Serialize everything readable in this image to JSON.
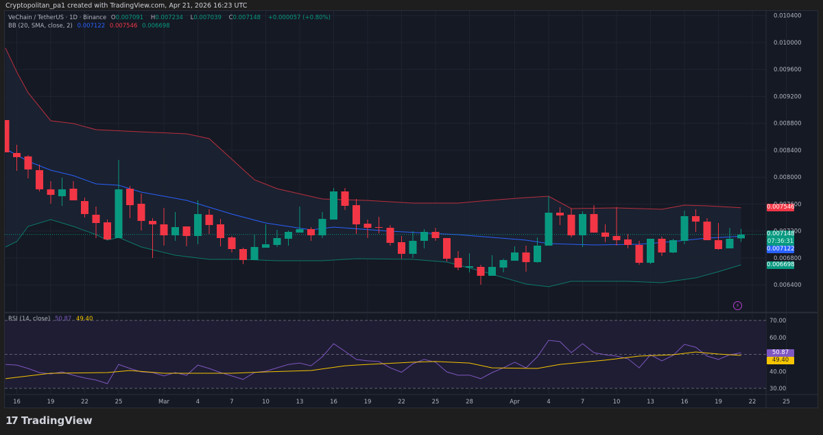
{
  "credit": "Cryptopolitan_pa1 created with TradingView.com, Apr 21, 2026 16:23 UTC",
  "legend": {
    "symbol": "VeChain / TetherUS · 1D · Binance",
    "o_label": "O",
    "o_value": "0.007091",
    "h_label": "H",
    "h_value": "0.007234",
    "l_label": "L",
    "l_value": "0.007039",
    "c_label": "C",
    "c_value": "0.007148",
    "change": "+0.000057 (+0.80%)",
    "bb_label": "BB (20, SMA, close, 2)",
    "bb_basis": "0.007122",
    "bb_upper": "0.007546",
    "bb_lower": "0.006698"
  },
  "rsi_legend": {
    "label": "RSI (14, close)",
    "rsi": "50.87",
    "ma": "49.40"
  },
  "tags": {
    "upper": "0.007546",
    "last": "0.007148",
    "countdown": "07:36:31",
    "basis": "0.007122",
    "lower": "0.006698",
    "rsi": "50.87",
    "rsi_ma": "49.40"
  },
  "colors": {
    "up": "#089981",
    "down": "#f23645",
    "bb_basis": "#2962ff",
    "bb_upper": "#f23645",
    "bb_lower": "#089981",
    "rsi": "#7e57c2",
    "rsi_ma": "#f7c600"
  },
  "footer": {
    "brand": "TradingView"
  },
  "icons": {
    "alert": "lightning-bolt-icon",
    "logo": "tradingview-logo-icon"
  },
  "chart_data": {
    "type": "candlestick",
    "price_axis": {
      "min": 0.0064,
      "max": 0.0104,
      "ticks": [
        "0.010400",
        "0.010000",
        "0.009600",
        "0.009200",
        "0.008800",
        "0.008400",
        "0.008000",
        "0.007600",
        "0.007200",
        "0.006800",
        "0.006400"
      ]
    },
    "rsi_axis": {
      "ticks": [
        "70.00",
        "60.00",
        "40.00",
        "30.00"
      ],
      "bands": [
        70,
        50,
        30
      ]
    },
    "x_ticks": [
      {
        "label": "16",
        "date": "2026-02-16"
      },
      {
        "label": "19",
        "date": "2026-02-19"
      },
      {
        "label": "22",
        "date": "2026-02-22"
      },
      {
        "label": "25",
        "date": "2026-02-25"
      },
      {
        "label": "Mar",
        "date": "2026-03-01"
      },
      {
        "label": "4",
        "date": "2026-03-04"
      },
      {
        "label": "7",
        "date": "2026-03-07"
      },
      {
        "label": "10",
        "date": "2026-03-10"
      },
      {
        "label": "13",
        "date": "2026-03-13"
      },
      {
        "label": "16",
        "date": "2026-03-16"
      },
      {
        "label": "19",
        "date": "2026-03-19"
      },
      {
        "label": "22",
        "date": "2026-03-22"
      },
      {
        "label": "25",
        "date": "2026-03-25"
      },
      {
        "label": "28",
        "date": "2026-03-28"
      },
      {
        "label": "Apr",
        "date": "2026-04-01"
      },
      {
        "label": "4",
        "date": "2026-04-04"
      },
      {
        "label": "7",
        "date": "2026-04-07"
      },
      {
        "label": "10",
        "date": "2026-04-10"
      },
      {
        "label": "13",
        "date": "2026-04-13"
      },
      {
        "label": "16",
        "date": "2026-04-16"
      },
      {
        "label": "19",
        "date": "2026-04-19"
      },
      {
        "label": "22",
        "date": "2026-04-22"
      },
      {
        "label": "25",
        "date": "2026-04-25"
      }
    ],
    "candles": {
      "start_date": "2026-02-15",
      "fields": [
        "open",
        "high",
        "low",
        "close"
      ],
      "rows": [
        [
          0.008848,
          0.008848,
          0.008369,
          0.008369
        ],
        [
          0.008359,
          0.008481,
          0.008094,
          0.008297
        ],
        [
          0.008308,
          0.008328,
          0.007982,
          0.008114
        ],
        [
          0.008104,
          0.008185,
          0.007788,
          0.007819
        ],
        [
          0.007819,
          0.007941,
          0.007605,
          0.007737
        ],
        [
          0.007717,
          0.007992,
          0.007574,
          0.007819
        ],
        [
          0.007829,
          0.007941,
          0.007656,
          0.007656
        ],
        [
          0.007645,
          0.007696,
          0.007401,
          0.007452
        ],
        [
          0.007442,
          0.007564,
          0.007095,
          0.007319
        ],
        [
          0.007329,
          0.00737,
          0.007064,
          0.007075
        ],
        [
          0.007095,
          0.008257,
          0.007095,
          0.007819
        ],
        [
          0.007829,
          0.00787,
          0.007391,
          0.007584
        ],
        [
          0.007605,
          0.007757,
          0.007207,
          0.00735
        ],
        [
          0.00735,
          0.007391,
          0.0068,
          0.007299
        ],
        [
          0.007299,
          0.007543,
          0.006983,
          0.007136
        ],
        [
          0.007136,
          0.007482,
          0.007054,
          0.007258
        ],
        [
          0.007268,
          0.007268,
          0.006973,
          0.007126
        ],
        [
          0.007126,
          0.007656,
          0.007003,
          0.007452
        ],
        [
          0.007442,
          0.007523,
          0.007156,
          0.007289
        ],
        [
          0.007299,
          0.00738,
          0.006973,
          0.007095
        ],
        [
          0.007105,
          0.007126,
          0.006881,
          0.006932
        ],
        [
          0.006932,
          0.006952,
          0.006708,
          0.006769
        ],
        [
          0.006769,
          0.007146,
          0.006769,
          0.006963
        ],
        [
          0.006952,
          0.007299,
          0.006952,
          0.007003
        ],
        [
          0.006993,
          0.007217,
          0.006963,
          0.007095
        ],
        [
          0.007085,
          0.007207,
          0.006983,
          0.007187
        ],
        [
          0.007177,
          0.007564,
          0.007177,
          0.007228
        ],
        [
          0.007228,
          0.007258,
          0.007054,
          0.007136
        ],
        [
          0.007136,
          0.007482,
          0.007095,
          0.00738
        ],
        [
          0.00737,
          0.007839,
          0.00737,
          0.007788
        ],
        [
          0.007788,
          0.007839,
          0.007513,
          0.007574
        ],
        [
          0.007584,
          0.007676,
          0.007156,
          0.007299
        ],
        [
          0.007309,
          0.00737,
          0.007095,
          0.007248
        ],
        [
          0.007258,
          0.007411,
          0.007166,
          0.007248
        ],
        [
          0.007248,
          0.007289,
          0.006983,
          0.007024
        ],
        [
          0.007034,
          0.007126,
          0.006789,
          0.006861
        ],
        [
          0.006861,
          0.007197,
          0.0068,
          0.007054
        ],
        [
          0.007054,
          0.007228,
          0.006942,
          0.007187
        ],
        [
          0.007187,
          0.007248,
          0.007054,
          0.007095
        ],
        [
          0.007095,
          0.007095,
          0.006749,
          0.006789
        ],
        [
          0.0068,
          0.006901,
          0.006616,
          0.006657
        ],
        [
          0.006657,
          0.006871,
          0.006586,
          0.006677
        ],
        [
          0.006667,
          0.006698,
          0.006402,
          0.006535
        ],
        [
          0.006535,
          0.00684,
          0.006535,
          0.006667
        ],
        [
          0.006657,
          0.006789,
          0.006586,
          0.006769
        ],
        [
          0.006759,
          0.006973,
          0.006759,
          0.006881
        ],
        [
          0.006881,
          0.006983,
          0.006596,
          0.006738
        ],
        [
          0.006738,
          0.007105,
          0.006728,
          0.006983
        ],
        [
          0.006983,
          0.007717,
          0.006983,
          0.007472
        ],
        [
          0.007472,
          0.007554,
          0.007289,
          0.007431
        ],
        [
          0.007442,
          0.007533,
          0.007105,
          0.007136
        ],
        [
          0.007136,
          0.007492,
          0.006963,
          0.007452
        ],
        [
          0.007452,
          0.007584,
          0.007177,
          0.007177
        ],
        [
          0.007177,
          0.007299,
          0.007034,
          0.007115
        ],
        [
          0.007126,
          0.007554,
          0.006983,
          0.007064
        ],
        [
          0.007075,
          0.007156,
          0.006942,
          0.006993
        ],
        [
          0.006993,
          0.007054,
          0.006698,
          0.006728
        ],
        [
          0.006728,
          0.007085,
          0.006708,
          0.007085
        ],
        [
          0.007085,
          0.007115,
          0.00683,
          0.006881
        ],
        [
          0.006881,
          0.007085,
          0.006871,
          0.007064
        ],
        [
          0.007054,
          0.007503,
          0.007003,
          0.007421
        ],
        [
          0.007421,
          0.007523,
          0.007187,
          0.00734
        ],
        [
          0.00734,
          0.007391,
          0.007064,
          0.007064
        ],
        [
          0.007064,
          0.007319,
          0.006922,
          0.006932
        ],
        [
          0.006942,
          0.007248,
          0.006942,
          0.007085
        ],
        [
          0.007091,
          0.007234,
          0.007039,
          0.007148
        ]
      ]
    },
    "bollinger": {
      "upper": [
        [
          0,
          0.009918
        ],
        [
          1,
          0.009561
        ],
        [
          2,
          0.009255
        ],
        [
          4,
          0.008838
        ],
        [
          6,
          0.008797
        ],
        [
          8,
          0.008705
        ],
        [
          12,
          0.008674
        ],
        [
          16,
          0.008644
        ],
        [
          18,
          0.008573
        ],
        [
          20,
          0.008267
        ],
        [
          22,
          0.007961
        ],
        [
          24,
          0.007829
        ],
        [
          28,
          0.007676
        ],
        [
          32,
          0.007655
        ],
        [
          36,
          0.007615
        ],
        [
          40,
          0.007615
        ],
        [
          42,
          0.007645
        ],
        [
          46,
          0.007696
        ],
        [
          48,
          0.007717
        ],
        [
          50,
          0.007533
        ],
        [
          54,
          0.007543
        ],
        [
          58,
          0.007523
        ],
        [
          60,
          0.007584
        ],
        [
          62,
          0.007574
        ],
        [
          65,
          0.007546
        ]
      ],
      "basis": [
        [
          0,
          0.00842
        ],
        [
          2,
          0.008236
        ],
        [
          4,
          0.008104
        ],
        [
          6,
          0.008022
        ],
        [
          8,
          0.0079
        ],
        [
          10,
          0.00788
        ],
        [
          12,
          0.007778
        ],
        [
          16,
          0.007656
        ],
        [
          20,
          0.007452
        ],
        [
          23,
          0.007319
        ],
        [
          27,
          0.007217
        ],
        [
          29,
          0.007258
        ],
        [
          34,
          0.007197
        ],
        [
          40,
          0.007146
        ],
        [
          46,
          0.007064
        ],
        [
          48,
          0.007013
        ],
        [
          52,
          0.006993
        ],
        [
          56,
          0.007003
        ],
        [
          59,
          0.007044
        ],
        [
          62,
          0.007095
        ],
        [
          65,
          0.007122
        ]
      ],
      "lower": [
        [
          0,
          0.006963
        ],
        [
          1,
          0.007044
        ],
        [
          2,
          0.007268
        ],
        [
          4,
          0.00737
        ],
        [
          6,
          0.007268
        ],
        [
          8,
          0.007146
        ],
        [
          9,
          0.007064
        ],
        [
          10,
          0.007105
        ],
        [
          12,
          0.006963
        ],
        [
          15,
          0.00684
        ],
        [
          18,
          0.006779
        ],
        [
          21,
          0.006779
        ],
        [
          24,
          0.006759
        ],
        [
          28,
          0.006759
        ],
        [
          31,
          0.006789
        ],
        [
          36,
          0.006779
        ],
        [
          39,
          0.006738
        ],
        [
          42,
          0.006606
        ],
        [
          46,
          0.006412
        ],
        [
          48,
          0.006372
        ],
        [
          50,
          0.006453
        ],
        [
          55,
          0.006453
        ],
        [
          58,
          0.006433
        ],
        [
          61,
          0.006504
        ],
        [
          63,
          0.006596
        ],
        [
          65,
          0.006698
        ]
      ]
    },
    "rsi": [
      44.1,
      43.7,
      41.7,
      39.3,
      38.5,
      39.7,
      37.7,
      36.1,
      34.9,
      32.8,
      44.1,
      41.7,
      39.7,
      39.3,
      37.3,
      39.3,
      37.7,
      43.7,
      41.7,
      39.3,
      37.3,
      35.3,
      39.3,
      40.1,
      42.1,
      44.1,
      44.9,
      43.3,
      48.6,
      56.3,
      51.8,
      47.0,
      46.2,
      45.8,
      42.1,
      39.5,
      44.5,
      47.0,
      45.4,
      39.7,
      37.7,
      37.8,
      35.7,
      39.3,
      42.1,
      45.4,
      42.1,
      48.6,
      58.3,
      57.5,
      51.0,
      56.3,
      51.0,
      49.8,
      49.0,
      47.4,
      42.1,
      49.8,
      46.2,
      49.4,
      55.9,
      54.2,
      49.0,
      47.0,
      49.8,
      50.87
    ],
    "rsi_ma": [
      [
        0,
        35.7
      ],
      [
        4,
        38.9
      ],
      [
        9,
        39.3
      ],
      [
        11,
        40.5
      ],
      [
        14,
        38.9
      ],
      [
        20,
        38.9
      ],
      [
        23,
        39.7
      ],
      [
        27,
        40.5
      ],
      [
        30,
        43.3
      ],
      [
        32,
        44.1
      ],
      [
        36,
        45.4
      ],
      [
        38,
        45.8
      ],
      [
        41,
        44.9
      ],
      [
        43,
        42.1
      ],
      [
        47,
        41.7
      ],
      [
        49,
        44.1
      ],
      [
        53,
        46.6
      ],
      [
        56,
        49.0
      ],
      [
        59,
        49.8
      ],
      [
        61,
        51.4
      ],
      [
        63,
        50.2
      ],
      [
        65,
        49.4
      ]
    ]
  }
}
